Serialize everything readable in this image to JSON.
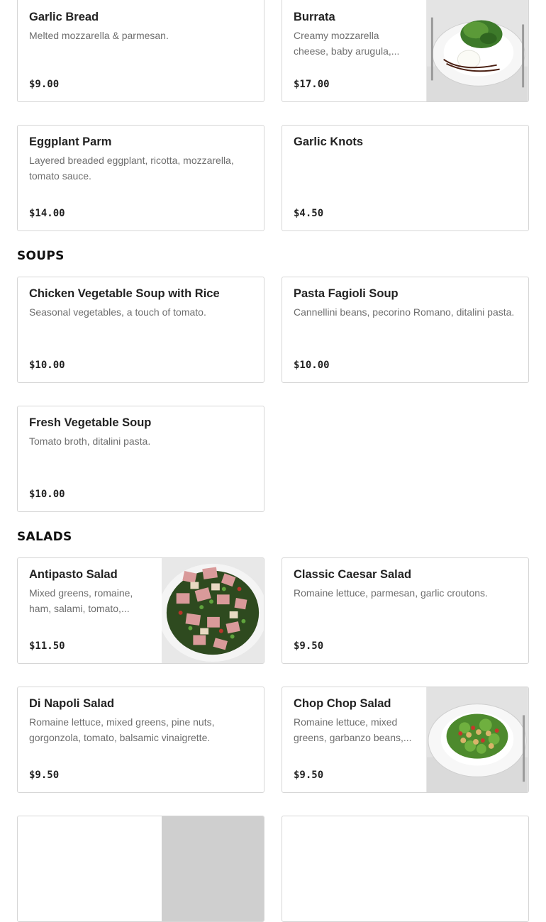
{
  "appetizers": {
    "items": [
      {
        "name": "Garlic Bread",
        "description": "Melted mozzarella & parmesan.",
        "price": "$9.00"
      },
      {
        "name": "Burrata",
        "description": "Creamy mozzarella cheese, baby arugula,...",
        "price": "$17.00"
      },
      {
        "name": "Eggplant Parm",
        "description": "Layered breaded eggplant, ricotta, mozzarella, tomato sauce.",
        "price": "$14.00"
      },
      {
        "name": "Garlic Knots",
        "description": "",
        "price": "$4.50"
      }
    ]
  },
  "soups": {
    "title": "SOUPS",
    "items": [
      {
        "name": "Chicken Vegetable Soup with Rice",
        "description": "Seasonal vegetables, a touch of tomato.",
        "price": "$10.00"
      },
      {
        "name": "Pasta Fagioli Soup",
        "description": "Cannellini beans, pecorino Romano, ditalini pasta.",
        "price": "$10.00"
      },
      {
        "name": "Fresh Vegetable Soup",
        "description": "Tomato broth, ditalini pasta.",
        "price": "$10.00"
      }
    ]
  },
  "salads": {
    "title": "SALADS",
    "items": [
      {
        "name": "Antipasto Salad",
        "description": "Mixed greens, romaine, ham, salami, tomato,...",
        "price": "$11.50"
      },
      {
        "name": "Classic Caesar Salad",
        "description": "Romaine lettuce, parmesan, garlic croutons.",
        "price": "$9.50"
      },
      {
        "name": "Di Napoli Salad",
        "description": "Romaine lettuce, mixed greens, pine nuts, gorgonzola, tomato, balsamic vinaigrette.",
        "price": "$9.50"
      },
      {
        "name": "Chop Chop Salad",
        "description": "Romaine lettuce, mixed greens, garbanzo beans,...",
        "price": "$9.50"
      }
    ]
  }
}
